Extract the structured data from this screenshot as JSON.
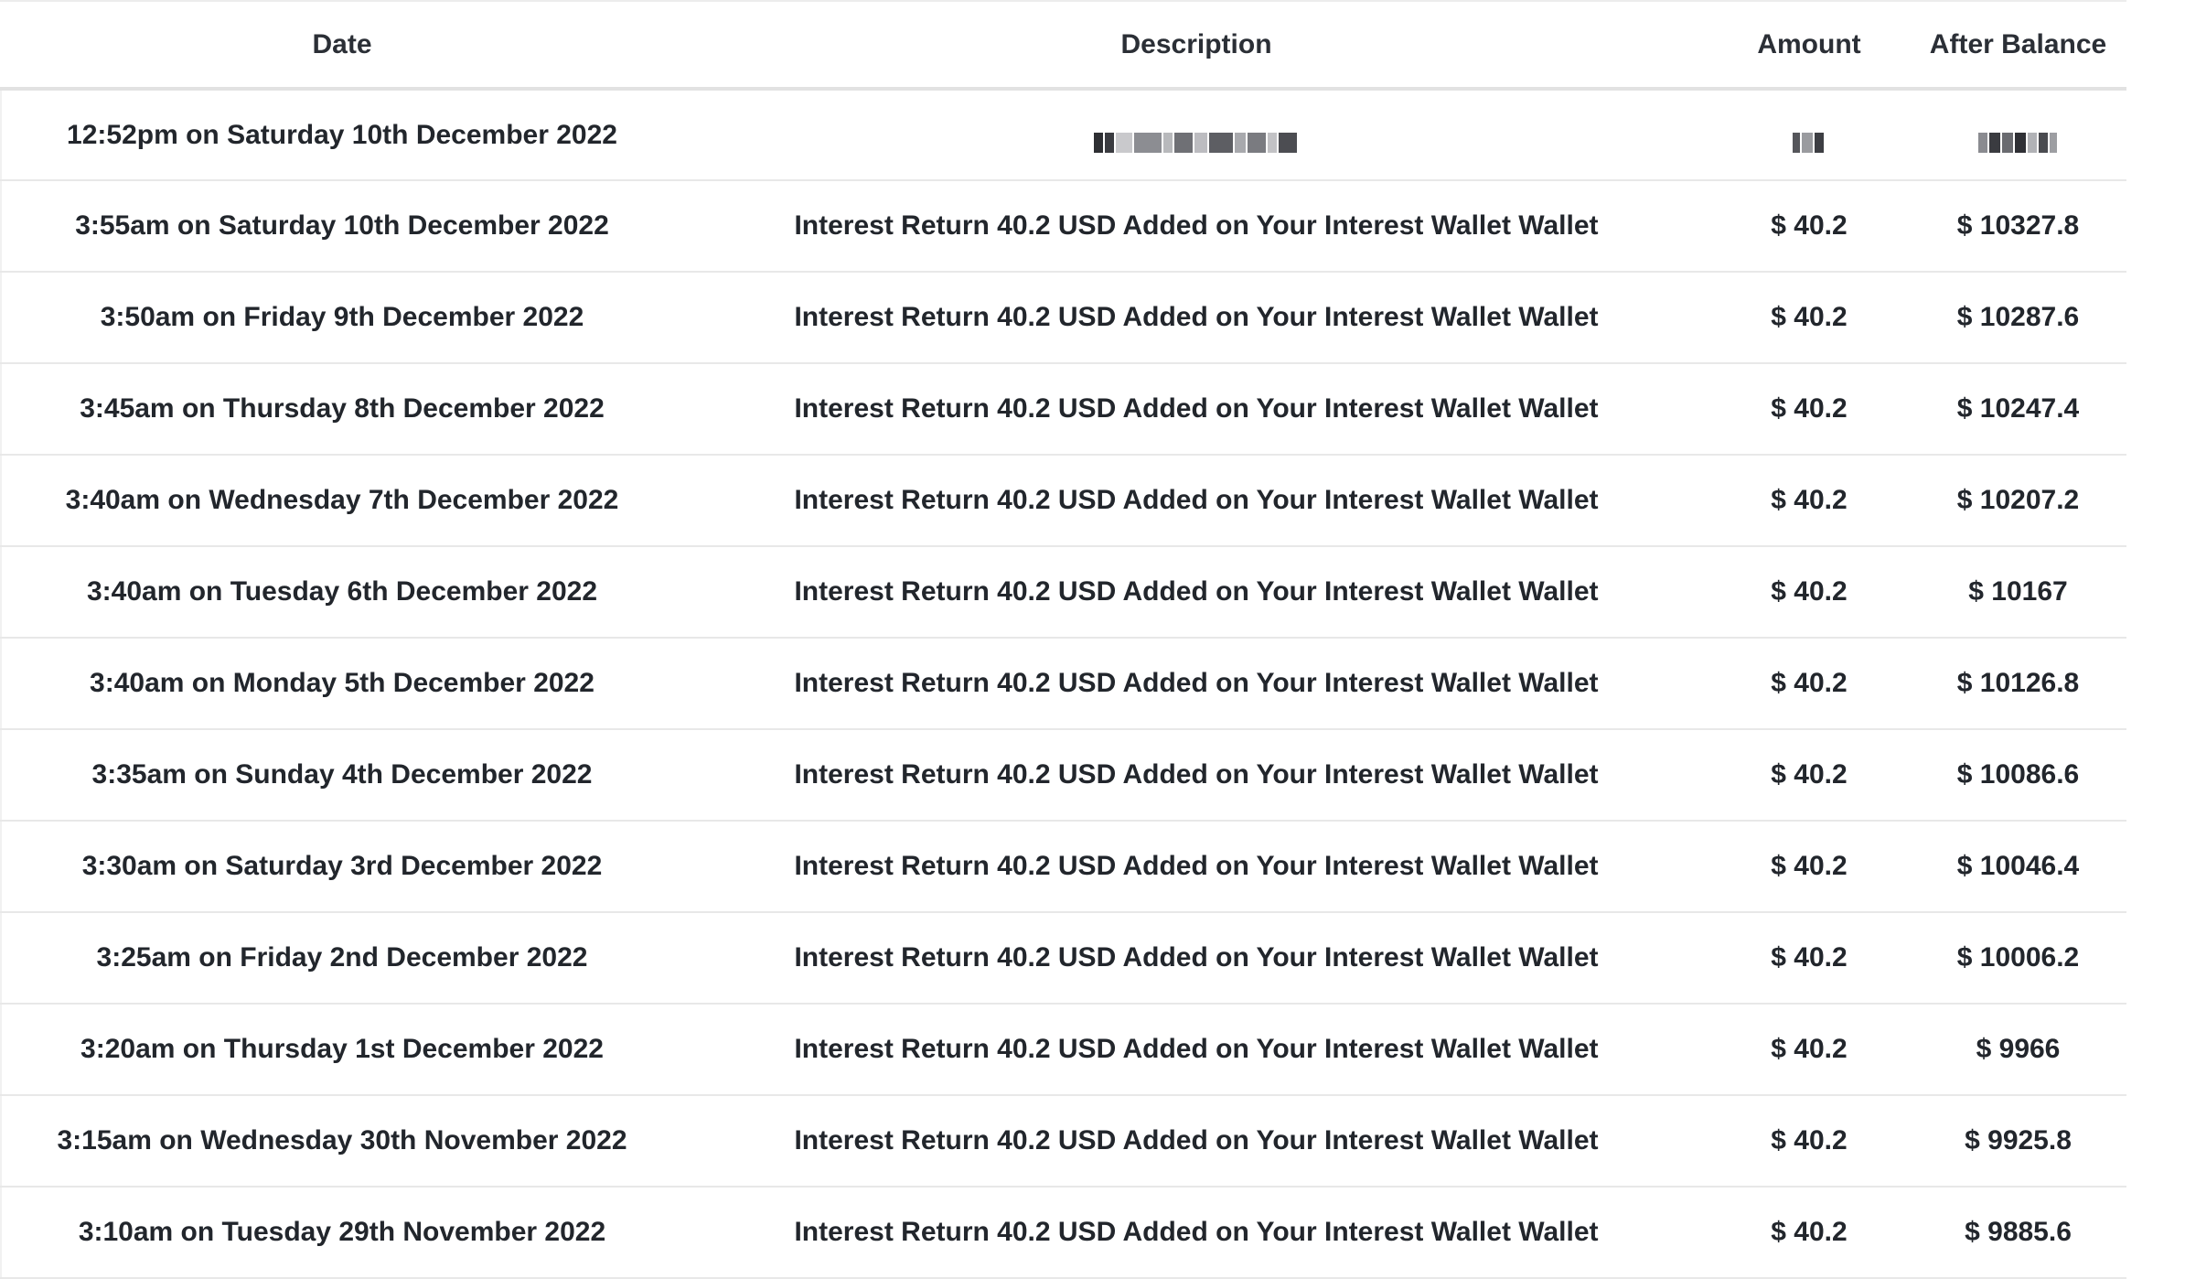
{
  "table": {
    "headers": {
      "date": "Date",
      "description": "Description",
      "amount": "Amount",
      "after_balance": "After Balance"
    },
    "redacted_row": {
      "date": "12:52pm on Saturday 10th December 2022"
    },
    "rows": [
      {
        "date": "3:55am on Saturday 10th December 2022",
        "description": "Interest Return 40.2 USD Added on Your Interest Wallet Wallet",
        "amount": "$ 40.2",
        "balance": "$ 10327.8"
      },
      {
        "date": "3:50am on Friday 9th December 2022",
        "description": "Interest Return 40.2 USD Added on Your Interest Wallet Wallet",
        "amount": "$ 40.2",
        "balance": "$ 10287.6"
      },
      {
        "date": "3:45am on Thursday 8th December 2022",
        "description": "Interest Return 40.2 USD Added on Your Interest Wallet Wallet",
        "amount": "$ 40.2",
        "balance": "$ 10247.4"
      },
      {
        "date": "3:40am on Wednesday 7th December 2022",
        "description": "Interest Return 40.2 USD Added on Your Interest Wallet Wallet",
        "amount": "$ 40.2",
        "balance": "$ 10207.2"
      },
      {
        "date": "3:40am on Tuesday 6th December 2022",
        "description": "Interest Return 40.2 USD Added on Your Interest Wallet Wallet",
        "amount": "$ 40.2",
        "balance": "$ 10167"
      },
      {
        "date": "3:40am on Monday 5th December 2022",
        "description": "Interest Return 40.2 USD Added on Your Interest Wallet Wallet",
        "amount": "$ 40.2",
        "balance": "$ 10126.8"
      },
      {
        "date": "3:35am on Sunday 4th December 2022",
        "description": "Interest Return 40.2 USD Added on Your Interest Wallet Wallet",
        "amount": "$ 40.2",
        "balance": "$ 10086.6"
      },
      {
        "date": "3:30am on Saturday 3rd December 2022",
        "description": "Interest Return 40.2 USD Added on Your Interest Wallet Wallet",
        "amount": "$ 40.2",
        "balance": "$ 10046.4"
      },
      {
        "date": "3:25am on Friday 2nd December 2022",
        "description": "Interest Return 40.2 USD Added on Your Interest Wallet Wallet",
        "amount": "$ 40.2",
        "balance": "$ 10006.2"
      },
      {
        "date": "3:20am on Thursday 1st December 2022",
        "description": "Interest Return 40.2 USD Added on Your Interest Wallet Wallet",
        "amount": "$ 40.2",
        "balance": "$ 9966"
      },
      {
        "date": "3:15am on Wednesday 30th November 2022",
        "description": "Interest Return 40.2 USD Added on Your Interest Wallet Wallet",
        "amount": "$ 40.2",
        "balance": "$ 9925.8"
      },
      {
        "date": "3:10am on Tuesday 29th November 2022",
        "description": "Interest Return 40.2 USD Added on Your Interest Wallet Wallet",
        "amount": "$ 40.2",
        "balance": "$ 9885.6"
      }
    ]
  }
}
